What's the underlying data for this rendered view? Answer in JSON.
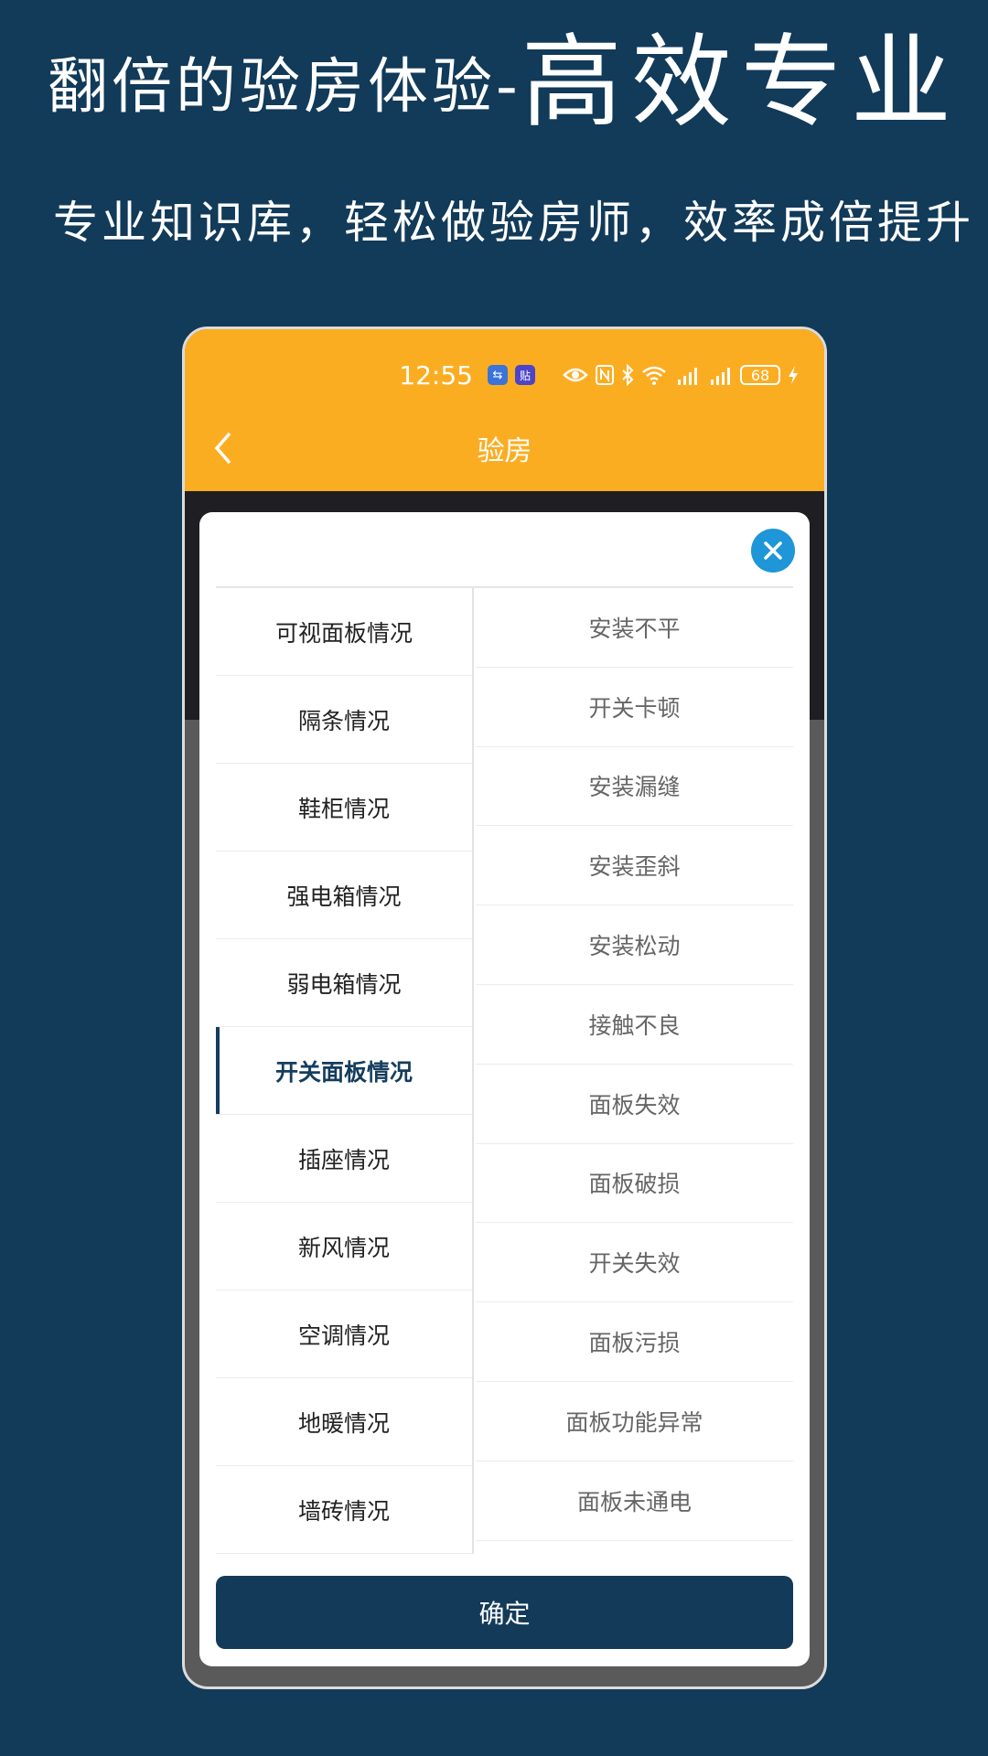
{
  "promo": {
    "title_small": "翻倍的验房体验-",
    "title_big": "高效专业",
    "subtitle": "专业知识库，轻松做验房师，效率成倍提升"
  },
  "status_bar": {
    "time": "12:55",
    "battery": "68"
  },
  "header": {
    "title": "验房"
  },
  "categories": [
    {
      "label": "可视面板情况",
      "active": false
    },
    {
      "label": "隔条情况",
      "active": false
    },
    {
      "label": "鞋柜情况",
      "active": false
    },
    {
      "label": "强电箱情况",
      "active": false
    },
    {
      "label": "弱电箱情况",
      "active": false
    },
    {
      "label": "开关面板情况",
      "active": true
    },
    {
      "label": "插座情况",
      "active": false
    },
    {
      "label": "新风情况",
      "active": false
    },
    {
      "label": "空调情况",
      "active": false
    },
    {
      "label": "地暖情况",
      "active": false
    },
    {
      "label": "墙砖情况",
      "active": false
    }
  ],
  "issues": [
    "安装不平",
    "开关卡顿",
    "安装漏缝",
    "安装歪斜",
    "安装松动",
    "接触不良",
    "面板失效",
    "面板破损",
    "开关失效",
    "面板污损",
    "面板功能异常",
    "面板未通电"
  ],
  "confirm_label": "确定",
  "colors": {
    "background": "#123a59",
    "header": "#fbad22",
    "accent": "#153d5e",
    "close_button": "#1e96d8"
  }
}
